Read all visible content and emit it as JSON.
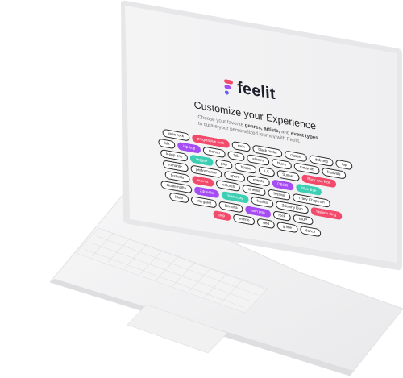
{
  "app": {
    "name": "Feelit"
  },
  "brand": {
    "wordmark": "feelit"
  },
  "screen": {
    "title": "Customize your Experience",
    "subtitle_pre": "Choose your favorite ",
    "subtitle_bold": "genres, artists,",
    "subtitle_mid": " and ",
    "subtitle_bold2": "event types",
    "subtitle_line2": "to curate your personalized journey with Feelit."
  },
  "colors": {
    "red": "#f24a6b",
    "purple": "#a54cf2",
    "teal": "#3ccfb4",
    "page_bg": "#f2f2f3"
  },
  "tag_rows": [
    [
      {
        "label": "indie rock",
        "selected": false
      },
      {
        "label": "progressive rock",
        "selected": true,
        "color": "red"
      },
      {
        "label": "rock",
        "selected": false
      },
      {
        "label": "black metal",
        "selected": false
      },
      {
        "label": "classic",
        "selected": false
      },
      {
        "label": "dubstep",
        "selected": false
      },
      {
        "label": "rap",
        "selected": false
      }
    ],
    [
      {
        "label": "folk",
        "selected": false
      },
      {
        "label": "hip hop",
        "selected": true,
        "color": "purple"
      },
      {
        "label": "techno",
        "selected": false
      },
      {
        "label": "folk",
        "selected": false
      },
      {
        "label": "electro",
        "selected": false
      },
      {
        "label": "blues",
        "selected": false
      },
      {
        "label": "romantic",
        "selected": false
      },
      {
        "label": "festivals",
        "selected": false
      }
    ],
    [
      {
        "label": "k-pop pop",
        "selected": false
      },
      {
        "label": "reggae",
        "selected": true,
        "color": "teal"
      },
      {
        "label": "pop",
        "selected": false
      },
      {
        "label": "house",
        "selected": false
      },
      {
        "label": "LA",
        "selected": false
      },
      {
        "label": "Sunset",
        "selected": false
      },
      {
        "label": "Rock and Roll",
        "selected": true,
        "color": "red"
      }
    ],
    [
      {
        "label": "romantic",
        "selected": false
      },
      {
        "label": "performance",
        "selected": false
      },
      {
        "label": "opera",
        "selected": false
      },
      {
        "label": "events",
        "selected": false
      },
      {
        "label": "DEOR",
        "selected": true,
        "color": "purple"
      },
      {
        "label": "Blue Eye",
        "selected": true,
        "color": "teal"
      }
    ],
    [
      {
        "label": "festivals",
        "selected": false
      },
      {
        "label": "events",
        "selected": true,
        "color": "red"
      },
      {
        "label": "lectures",
        "selected": false
      },
      {
        "label": "cinema",
        "selected": false
      },
      {
        "label": "festival",
        "selected": false
      },
      {
        "label": "Tracy Chapman",
        "selected": false
      }
    ],
    [
      {
        "label": "Guatemalfia",
        "selected": false
      },
      {
        "label": "Zdravilis",
        "selected": true,
        "color": "purple"
      },
      {
        "label": "Yesterday",
        "selected": true,
        "color": "teal"
      },
      {
        "label": "festival",
        "selected": false
      },
      {
        "label": "Zdenthy Duo",
        "selected": false
      },
      {
        "label": "fashion ding",
        "selected": true,
        "color": "red"
      }
    ],
    [
      {
        "label": "Mahi",
        "selected": false
      },
      {
        "label": "Margaret",
        "selected": false
      },
      {
        "label": "Brindha",
        "selected": false
      },
      {
        "label": "latin pop",
        "selected": true,
        "color": "purple"
      },
      {
        "label": "rock",
        "selected": false
      },
      {
        "label": "MOP",
        "selected": false
      }
    ],
    [
      {
        "label": "pop",
        "selected": true,
        "color": "red"
      },
      {
        "label": "techno",
        "selected": false
      },
      {
        "label": "dnd",
        "selected": false
      },
      {
        "label": "grime",
        "selected": false
      },
      {
        "label": "dance",
        "selected": false
      }
    ]
  ]
}
